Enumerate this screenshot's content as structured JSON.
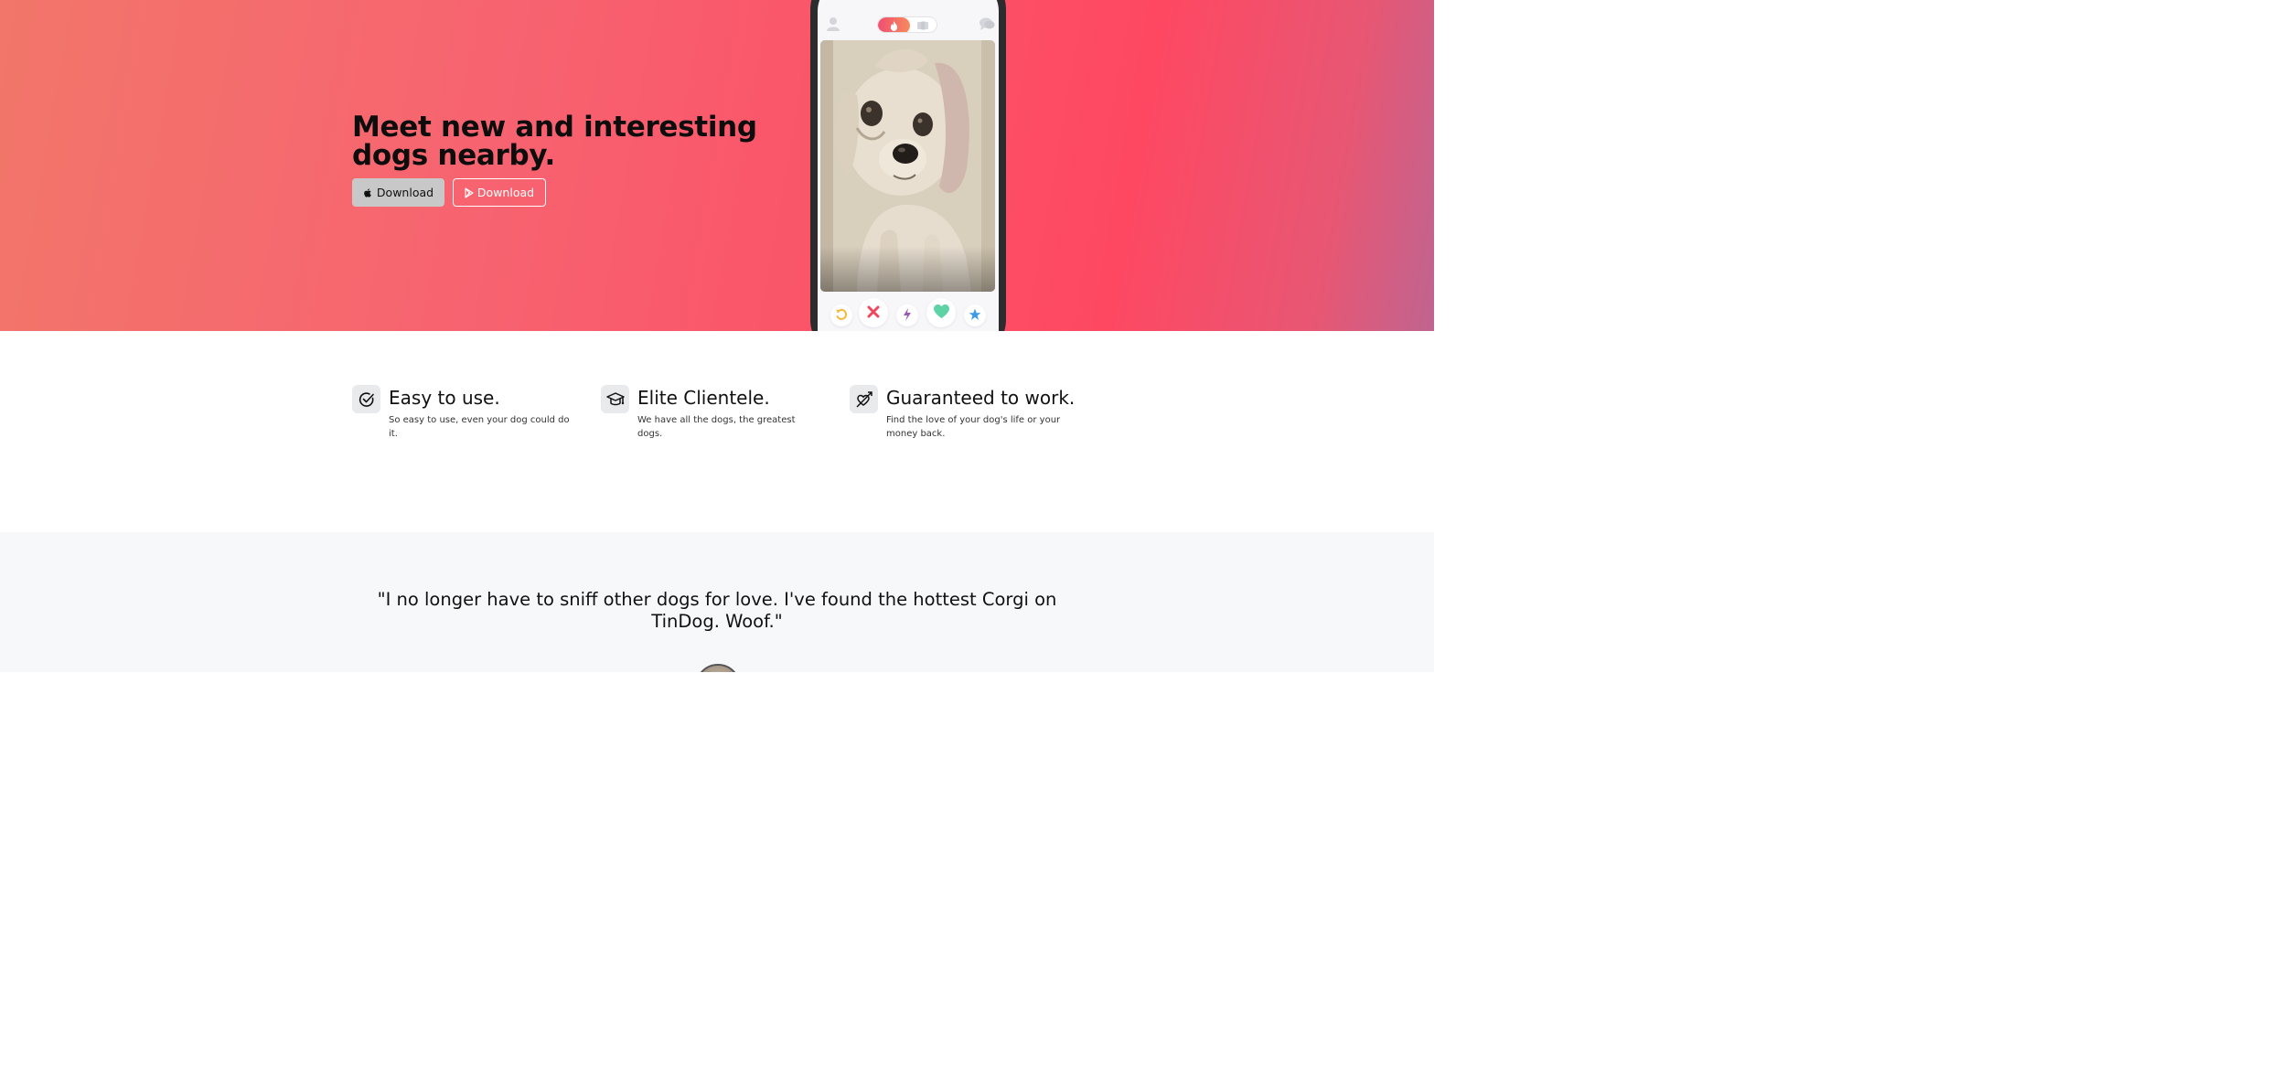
{
  "hero": {
    "title_line1": "Meet new and interesting",
    "title_line2": "dogs nearby.",
    "apple_button_label": "Download",
    "play_button_label": "Download"
  },
  "phone": {
    "icons": {
      "profile": "profile-icon",
      "flame": "flame-icon",
      "swipe": "swipe-icon",
      "messages": "messages-icon"
    },
    "photo": "dog-photo",
    "actions": [
      "rewind-icon",
      "nope-icon",
      "boost-icon",
      "like-icon",
      "superlike-icon"
    ],
    "colors": {
      "rewind": "#f5b93a",
      "nope": "#f0465e",
      "boost": "#9b59b6",
      "like": "#5fd3a5",
      "superlike": "#3d9ae8"
    }
  },
  "features": [
    {
      "icon": "check-circle-icon",
      "title": "Easy to use.",
      "text": "So easy to use, even your dog could do it."
    },
    {
      "icon": "graduation-cap-icon",
      "title": "Elite Clientele.",
      "text": "We have all the dogs, the greatest dogs."
    },
    {
      "icon": "heart-arrow-icon",
      "title": "Guaranteed to work.",
      "text": "Find the love of your dog's life or your money back."
    }
  ],
  "testimonial": {
    "quote": "\"I no longer have to sniff other dogs for love. I've found the hottest Corgi on TinDog. Woof.\""
  },
  "colors": {
    "hero_gradient_start": "#f2766a",
    "hero_gradient_mid": "#fe4862",
    "hero_gradient_end": "#c06490",
    "apple_button_bg": "#c8c8c8",
    "testimonial_bg": "#f7f8fa"
  }
}
